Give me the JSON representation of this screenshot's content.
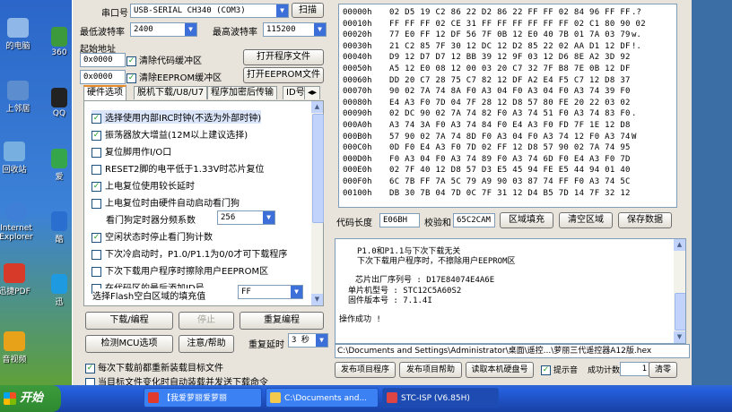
{
  "desktop": {
    "icons": [
      {
        "label": "的电脑"
      },
      {
        "label": "上邻居"
      },
      {
        "label": "回收站"
      },
      {
        "label": "Internet Explorer"
      },
      {
        "label": "迅捷PDF"
      },
      {
        "label": "音视频"
      }
    ],
    "icons_right": [
      {
        "label": "360"
      },
      {
        "label": "QQ"
      },
      {
        "label": "爱"
      },
      {
        "label": "酷"
      },
      {
        "label": "迅"
      }
    ]
  },
  "port": {
    "label": "串口号",
    "value": "USB-SERIAL CH340 (COM3)",
    "scan": "扫描"
  },
  "baud_min": {
    "label": "最低波特率",
    "value": "2400"
  },
  "baud_max": {
    "label": "最高波特率",
    "value": "115200"
  },
  "start_addr": {
    "label": "起始地址",
    "code_addr": "0x0000",
    "eeprom_addr": "0x0000",
    "clear_code": "清除代码缓冲区",
    "clear_eeprom": "清除EEPROM缓冲区",
    "open_program": "打开程序文件",
    "open_eeprom": "打开EEPROM文件"
  },
  "tabs": [
    "硬件选项",
    "脱机下载/U8/U7",
    "程序加密后传输",
    "ID号"
  ],
  "options": [
    {
      "checked": true,
      "label": "选择使用内部IRC时钟(不选为外部时钟)"
    },
    {
      "checked": true,
      "label": "振荡器放大增益(12M以上建议选择)"
    },
    {
      "checked": false,
      "label": "复位脚用作I/O口"
    },
    {
      "checked": false,
      "label": "RESET2脚的电平低于1.33V时芯片复位"
    },
    {
      "checked": true,
      "label": "上电复位使用较长延时"
    },
    {
      "checked": false,
      "label": "上电复位时由硬件自动启动看门狗"
    },
    {
      "checked": null,
      "label": "看门狗定时器分频系数"
    },
    {
      "checked": true,
      "label": "空闲状态时停止看门狗计数"
    },
    {
      "checked": false,
      "label": "下次冷启动时，P1.0/P1.1为0/0才可下载程序"
    },
    {
      "checked": false,
      "label": "下次下载用户程序时擦除用户EEPROM区"
    },
    {
      "checked": false,
      "label": "在代码区的最后添加ID号"
    }
  ],
  "watchdog_div": "256",
  "fill_label": "选择Flash空白区域的填充值",
  "fill_value": "FF",
  "buttons": {
    "download": "下载/编程",
    "stop": "停止",
    "reprogram": "重复编程",
    "detect": "检测MCU选项",
    "help": "注意/帮助",
    "repeat_delay_label": "重复延时",
    "repeat_delay_value": "3 秒"
  },
  "bottom_checks": [
    {
      "checked": true,
      "label": "每次下载前都重新装载目标文件"
    },
    {
      "checked": false,
      "label": "当目标文件变化时自动装载并发送下载命令"
    }
  ],
  "hex": {
    "rows": [
      {
        "addr": "00000h",
        "bytes": "02 D5 19 C2 86 22 D2 86 22 FF FF 02 84 96 FF FF",
        "ascii": ".?"
      },
      {
        "addr": "00010h",
        "bytes": "FF FF FF 02 CE 31 FF FF FF FF FF FF 02 C1 80 90 02",
        "ascii": ""
      },
      {
        "addr": "00020h",
        "bytes": "77 E0 FF 12 DF 56 7F 0B 12 E0 40 7B 01 7A 03 79",
        "ascii": "w."
      },
      {
        "addr": "00030h",
        "bytes": "21 C2 85 7F 30 12 DC 12 D2 85 22 02 AA D1 12 DF",
        "ascii": "!."
      },
      {
        "addr": "00040h",
        "bytes": "D9 12 D7 D7 12 BB 39 12 9F 03 12 D6 8E A2 3D 92",
        "ascii": ""
      },
      {
        "addr": "00050h",
        "bytes": "A5 12 E0 08 12 00 03 20 C7 32 7F B8 7E 0B 12 DF",
        "ascii": ""
      },
      {
        "addr": "00060h",
        "bytes": "DD 20 C7 28 75 C7 82 12 DF A2 E4 F5 C7 12 D8 37",
        "ascii": ""
      },
      {
        "addr": "00070h",
        "bytes": "90 02 7A 74 8A F0 A3 04 F0 A3 04 F0 A3 74 39 F0",
        "ascii": ""
      },
      {
        "addr": "00080h",
        "bytes": "E4 A3 F0 7D 04 7F 28 12 D8 57 80 FE 20 22 03 02",
        "ascii": ""
      },
      {
        "addr": "00090h",
        "bytes": "02 DC 90 02 7A 74 82 F0 A3 74 51 F0 A3 74 83 F0",
        "ascii": "."
      },
      {
        "addr": "000A0h",
        "bytes": "A3 74 3A F0 A3 74 84 F0 E4 A3 F0 FD 7F 1E 12 D8",
        "ascii": ""
      },
      {
        "addr": "000B0h",
        "bytes": "57 90 02 7A 74 8D F0 A3 04 F0 A3 74 12 F0 A3 74",
        "ascii": "W"
      },
      {
        "addr": "000C0h",
        "bytes": "0D F0 E4 A3 F0 7D 02 FF 12 D8 57 90 02 7A 74 95",
        "ascii": ""
      },
      {
        "addr": "000D0h",
        "bytes": "F0 A3 04 F0 A3 74 89 F0 A3 74 6D F0 E4 A3 F0 7D",
        "ascii": ""
      },
      {
        "addr": "000E0h",
        "bytes": "02 7F 40 12 D8 57 D3 E5 45 94 FE E5 44 94 01 40",
        "ascii": ""
      },
      {
        "addr": "000F0h",
        "bytes": "6C 7B FF 7A 5C 79 A9 90 03 87 74 FF F0 A3 74 5C",
        "ascii": ""
      },
      {
        "addr": "00100h",
        "bytes": "DB 30 7B 04 7D 0C 7F 31 12 D4 B5 7D 14 7F 32 12",
        "ascii": ""
      }
    ]
  },
  "code_len": {
    "label": "代码长度",
    "value": "E06BH"
  },
  "checksum": {
    "label": "校验和",
    "value": "65C2CAM"
  },
  "hex_buttons": {
    "fill": "区域填充",
    "clear": "清空区域",
    "save": "保存数据"
  },
  "messages": [
    "P1.0和P1.1与下次下载无关",
    "下次下载用户程序时，不擦除用户EEPROM区",
    "芯片出厂序列号 : D17E84074E4A6E",
    "单片机型号 : STC12C5A60S2",
    "固件版本号 : 7.1.4I",
    "操作成功 !"
  ],
  "file_path": "C:\\Documents and Settings\\Administrator\\桌面\\遥控...\\萝丽三代遥控器A12版.hex",
  "bottom": {
    "publish": "发布项目程序",
    "publish_help": "发布项目帮助",
    "read_disk": "读取本机硬盘号",
    "beep": "提示音",
    "count_label": "成功计数",
    "count_value": "1",
    "clear": "清零"
  },
  "taskbar": {
    "start": "开始",
    "tasks": [
      "【我爱萝丽爱萝丽",
      "C:\\Documents and...",
      "STC-ISP (V6.85H)"
    ]
  },
  "colors": {
    "accent": "#3d6fd8",
    "check": "#21a121",
    "tab_hl": "#e68b2c"
  }
}
